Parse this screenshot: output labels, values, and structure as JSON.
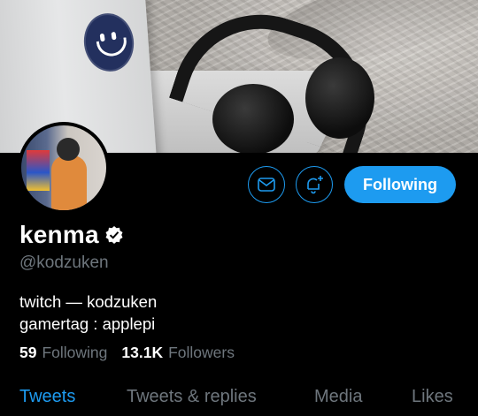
{
  "profile": {
    "name": "kenma",
    "handle": "@kodzuken",
    "bio_line1": "twitch — kodzuken",
    "bio_line2": "gamertag : applepi",
    "following_count": "59",
    "following_label": "Following",
    "followers_count": "13.1K",
    "followers_label": "Followers"
  },
  "actions": {
    "mail_icon": "envelope-icon",
    "bell_icon": "bell-plus-icon",
    "follow_label": "Following"
  },
  "tabs": [
    {
      "label": "Tweets",
      "active": true
    },
    {
      "label": "Tweets & replies",
      "active": false
    },
    {
      "label": "Media",
      "active": false
    },
    {
      "label": "Likes",
      "active": false
    }
  ],
  "colors": {
    "accent": "#1d9bf0",
    "muted": "#6e767d",
    "background": "#000000"
  }
}
